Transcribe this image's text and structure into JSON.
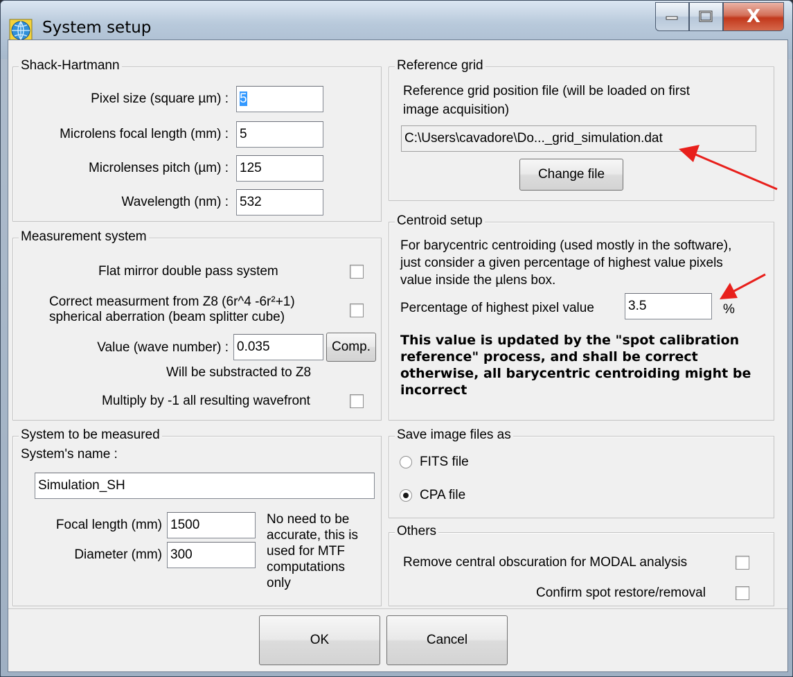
{
  "window": {
    "title": "System setup",
    "icon": "globe-icon",
    "caption": {
      "minimize": "minimize-icon",
      "maximize": "maximize-icon",
      "close": "X"
    }
  },
  "shack_hartmann": {
    "title": "Shack-Hartmann",
    "pixel_size_label": "Pixel size (square µm) :",
    "pixel_size_value": "5",
    "focal_length_label": "Microlens focal length (mm) :",
    "focal_length_value": "5",
    "pitch_label": "Microlenses pitch (µm) :",
    "pitch_value": "125",
    "wavelength_label": "Wavelength (nm) :",
    "wavelength_value": "532"
  },
  "measurement": {
    "title": "Measurement system",
    "flat_mirror_label": "Flat mirror double pass system",
    "flat_mirror_checked": false,
    "correct_line1": "Correct measurment from Z8 (6r^4 -6r²+1)",
    "correct_line2": "spherical aberration (beam splitter cube)",
    "correct_checked": false,
    "value_label": "Value (wave number) :",
    "value": "0.035",
    "comp_button": "Comp.",
    "substract_note": "Will be substracted to Z8",
    "multiply_label": "Multiply by -1 all resulting wavefront",
    "multiply_checked": false
  },
  "system": {
    "title": "System to be measured",
    "name_label": "System's name :",
    "name_value": "Simulation_SH",
    "focal_label": "Focal length (mm)",
    "focal_value": "1500",
    "diameter_label": "Diameter (mm)",
    "diameter_value": "300",
    "note_lines": [
      "No need to be",
      "accurate, this is",
      "used for MTF",
      "computations",
      "only"
    ]
  },
  "reference_grid": {
    "title": "Reference grid",
    "desc_line1": "Reference grid position file (will be loaded on first",
    "desc_line2": "image acquisition)",
    "path": "C:\\Users\\cavadore\\Do..._grid_simulation.dat",
    "change_button": "Change file"
  },
  "centroid": {
    "title": "Centroid setup",
    "desc_line1": "For barycentric centroiding (used mostly in the software),",
    "desc_line2": "just consider a given percentage of highest value pixels",
    "desc_line3": "value inside the µlens box.",
    "pct_label": "Percentage of highest pixel value",
    "pct_value": "3.5",
    "pct_unit": "%",
    "warning_lines": [
      "This value is updated by the \"spot calibration",
      "reference\" process, and shall be correct",
      "otherwise, all barycentric centroiding might be",
      "incorrect"
    ]
  },
  "save_image": {
    "title": "Save image files as",
    "fits_label": "FITS file",
    "cpa_label": "CPA file",
    "selected": "CPA file"
  },
  "others": {
    "title": "Others",
    "remove_label": "Remove central obscuration for MODAL analysis",
    "remove_checked": false,
    "confirm_label": "Confirm spot restore/removal",
    "confirm_checked": false
  },
  "buttons": {
    "ok": "OK",
    "cancel": "Cancel"
  },
  "colors": {
    "annotation_arrow": "#e8201c",
    "selection": "#3399ff"
  }
}
